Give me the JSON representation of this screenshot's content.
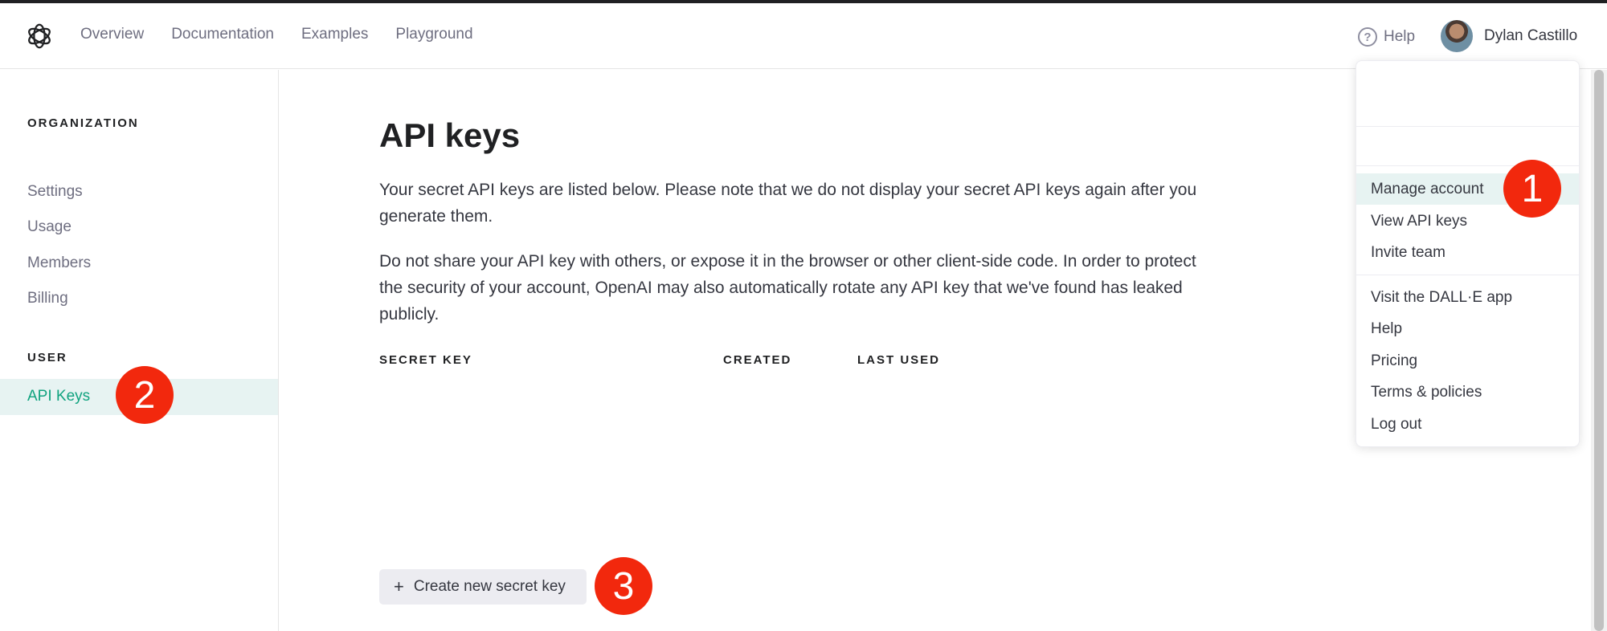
{
  "topbar": {
    "nav": [
      "Overview",
      "Documentation",
      "Examples",
      "Playground"
    ],
    "help_label": "Help",
    "user_name": "Dylan Castillo"
  },
  "sidebar": {
    "org_header": "ORGANIZATION",
    "org_items": [
      "Settings",
      "Usage",
      "Members",
      "Billing"
    ],
    "user_header": "USER",
    "user_items": [
      "API Keys"
    ]
  },
  "main": {
    "title": "API keys",
    "para1": "Your secret API keys are listed below. Please note that we do not display your secret API keys again after you generate them.",
    "para2": "Do not share your API key with others, or expose it in the browser or other client-side code. In order to protect the security of your account, OpenAI may also automatically rotate any API key that we've found has leaked publicly.",
    "columns": [
      "SECRET KEY",
      "CREATED",
      "LAST USED"
    ],
    "create_button": "Create new secret key"
  },
  "user_menu": {
    "group1": [
      "Manage account",
      "View API keys",
      "Invite team"
    ],
    "group2": [
      "Visit the DALL·E app",
      "Help",
      "Pricing",
      "Terms & policies",
      "Log out"
    ]
  },
  "annotations": [
    "1",
    "2",
    "3"
  ],
  "colors": {
    "accent": "#10a37f",
    "highlight_bg": "#e7f3f2",
    "badge": "#f2280d"
  }
}
